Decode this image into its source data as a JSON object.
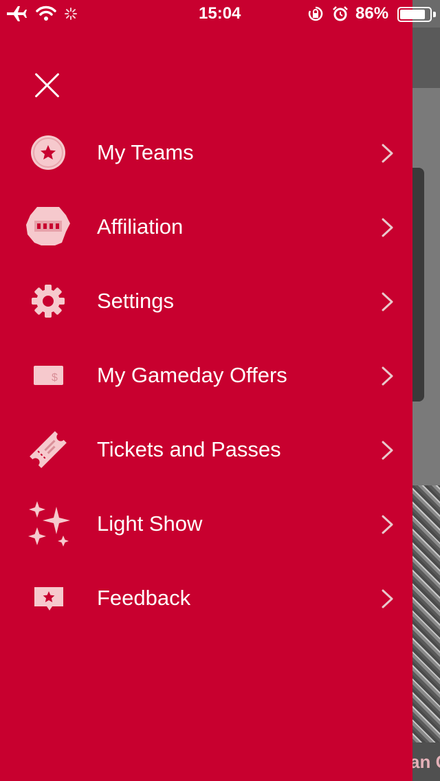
{
  "status_bar": {
    "time": "15:04",
    "battery": "86%",
    "battery_level": 0.86
  },
  "background_app": {
    "caption": "an C"
  },
  "drawer": {
    "close_icon": "close-icon",
    "items": [
      {
        "label": "My Teams",
        "icon": "star-badge-icon"
      },
      {
        "label": "Affiliation",
        "icon": "team-logo-icon"
      },
      {
        "label": "Settings",
        "icon": "gear-icon"
      },
      {
        "label": "My Gameday Offers",
        "icon": "dollar-card-icon"
      },
      {
        "label": "Tickets and Passes",
        "icon": "ticket-icon"
      },
      {
        "label": "Light Show",
        "icon": "sparkles-icon"
      },
      {
        "label": "Feedback",
        "icon": "feedback-bubble-icon"
      }
    ]
  },
  "colors": {
    "brand": "#c8002f",
    "icon": "#f6c9cd",
    "text": "#ffffff",
    "chevron": "#e9c8cc"
  }
}
